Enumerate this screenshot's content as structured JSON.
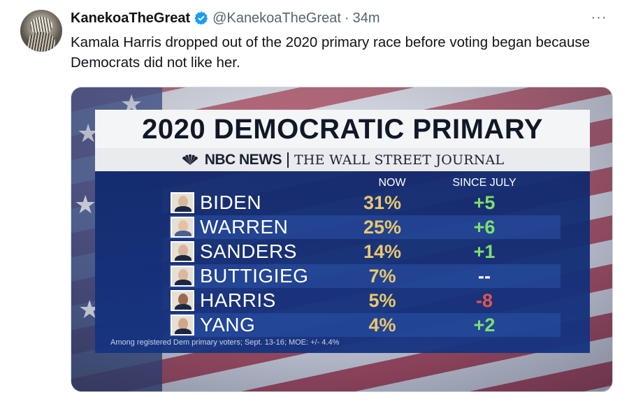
{
  "tweet": {
    "display_name": "KanekoaTheGreat",
    "handle": "@KanekoaTheGreat",
    "separator": "·",
    "timestamp": "34m",
    "more_label": "···",
    "text": "Kamala Harris dropped out of the 2020 primary race before voting began because Democrats did not like her."
  },
  "graphic": {
    "title": "2020 DEMOCRATIC PRIMARY",
    "source_nbc": "NBC NEWS",
    "source_wsj": "THE WALL STREET JOURNAL",
    "col_now": "NOW",
    "col_since": "SINCE JULY",
    "rows": [
      {
        "name": "BIDEN",
        "now": "31%",
        "since": "+5"
      },
      {
        "name": "WARREN",
        "now": "25%",
        "since": "+6"
      },
      {
        "name": "SANDERS",
        "now": "14%",
        "since": "+1"
      },
      {
        "name": "BUTTIGIEG",
        "now": "7%",
        "since": "--"
      },
      {
        "name": "HARRIS",
        "now": "5%",
        "since": "-8"
      },
      {
        "name": "YANG",
        "now": "4%",
        "since": "+2"
      }
    ],
    "footnote": "Among registered Dem primary voters; Sept. 13-16; MOE: +/- 4.4%"
  },
  "colors": {
    "verified": "#1d9bf0",
    "now_value": "#e9c86b",
    "positive": "#7ee06c",
    "negative": "#e25555",
    "table_bg": "#163480"
  },
  "icons": {
    "verified": "verified-badge-icon",
    "more": "more-options-icon",
    "nbc": "nbc-peacock-icon"
  }
}
